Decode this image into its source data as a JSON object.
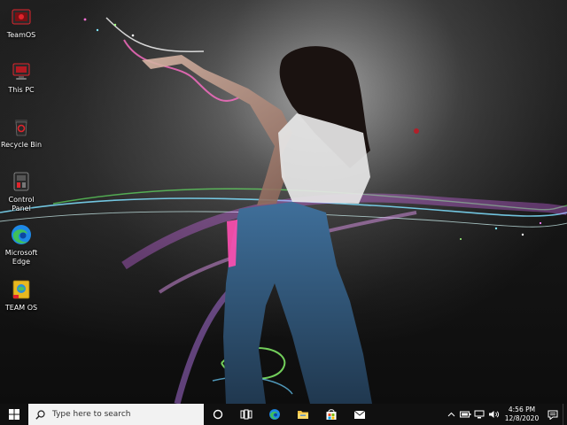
{
  "desktop": {
    "icons": [
      {
        "label": "TeamOS",
        "icon": "teamos-folder-icon"
      },
      {
        "label": "This PC",
        "icon": "computer-icon"
      },
      {
        "label": "Recycle Bin",
        "icon": "recycle-bin-icon"
      },
      {
        "label": "Control Panel",
        "icon": "control-panel-icon"
      },
      {
        "label": "Microsoft Edge",
        "icon": "edge-icon"
      },
      {
        "label": "TEAM OS",
        "icon": "team-os-shortcut-icon"
      }
    ]
  },
  "taskbar": {
    "search_placeholder": "Type here to search",
    "pinned": [
      "cortana-icon",
      "task-view-icon",
      "edge-icon",
      "file-explorer-icon",
      "store-icon",
      "mail-icon"
    ],
    "tray": [
      "chevron-up-icon",
      "battery-icon",
      "network-icon",
      "volume-icon"
    ],
    "clock": {
      "time": "4:56 PM",
      "date": "12/8/2020"
    }
  },
  "colors": {
    "taskbar_bg": "#101010",
    "search_bg": "#f2f2f2",
    "accent_red": "#e0242c",
    "edge_blue": "#1e88e5",
    "edge_green": "#3fbf5a"
  }
}
